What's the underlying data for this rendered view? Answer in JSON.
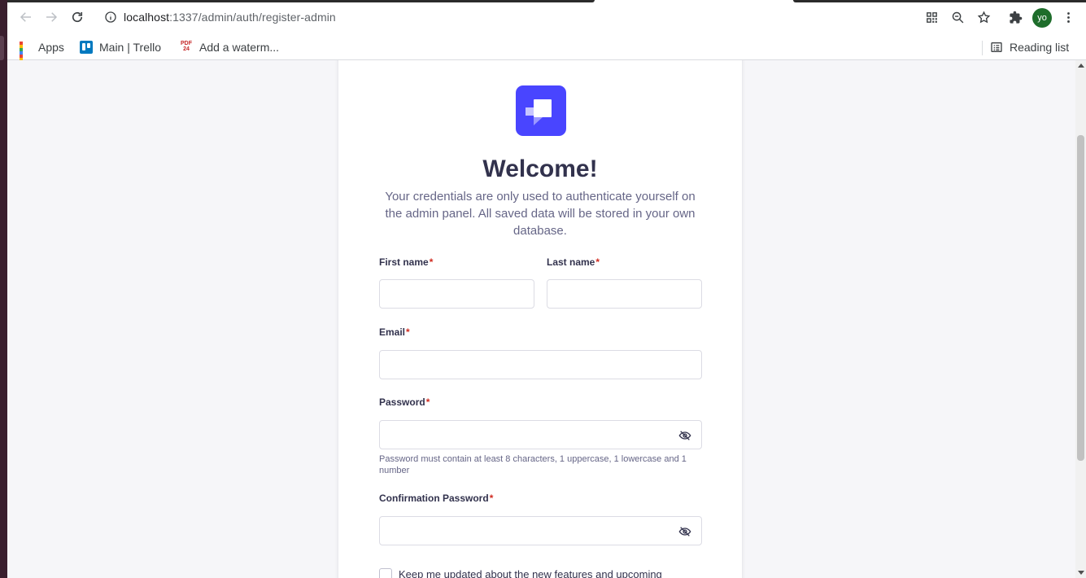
{
  "browser": {
    "url_host": "localhost",
    "url_path": ":1337/admin/auth/register-admin",
    "avatar_initials": "yo",
    "bookmarks": [
      {
        "label": "Apps",
        "icon": "apps-grid-icon"
      },
      {
        "label": "Main | Trello",
        "icon": "trello-icon"
      },
      {
        "label": "Add a waterm...",
        "icon": "pdf24-icon"
      }
    ],
    "pdf_icon_text_top": "PDF",
    "pdf_icon_text_bottom": "24",
    "reading_list_label": "Reading list"
  },
  "form": {
    "title": "Welcome!",
    "subtitle": "Your credentials are only used to authenticate yourself on the admin panel. All saved data will be stored in your own database.",
    "first_name_label": "First name",
    "last_name_label": "Last name",
    "email_label": "Email",
    "password_label": "Password",
    "password_hint": "Password must contain at least 8 characters, 1 uppercase, 1 lowercase and 1 number",
    "confirm_password_label": "Confirmation Password",
    "required_marker": "*",
    "newsletter_label": "Keep me updated about the new features and upcoming"
  },
  "colors": {
    "brand": "#4945ff",
    "required": "#d02b20",
    "heading": "#32324d",
    "muted": "#666687"
  }
}
